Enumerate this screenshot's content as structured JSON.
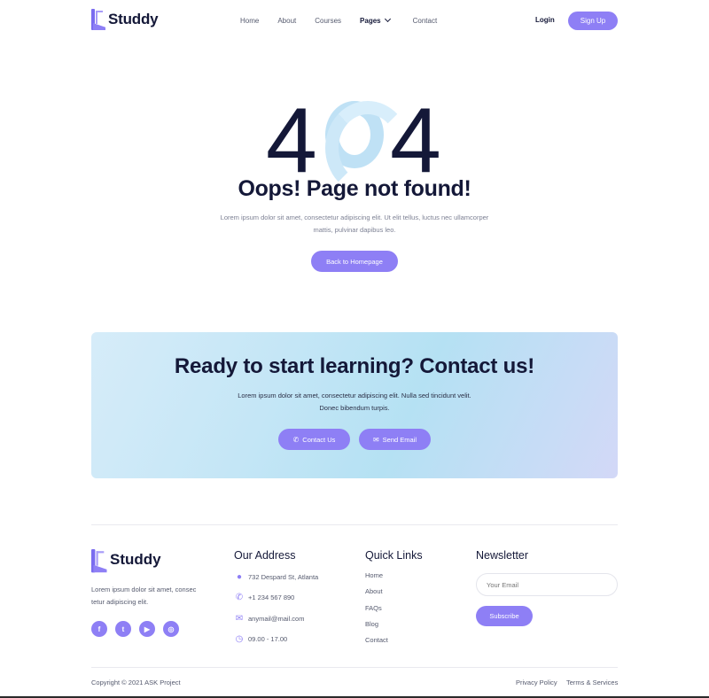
{
  "header": {
    "brand": "Studdy",
    "nav": [
      "Home",
      "About",
      "Courses",
      "Pages",
      "Contact"
    ],
    "login": "Login",
    "signup": "Sign Up"
  },
  "hero": {
    "code_left": "4",
    "code_right": "4",
    "title": "Oops! Page not found!",
    "text": "Lorem ipsum dolor sit amet, consectetur adipiscing elit. Ut elit tellus, luctus nec ullamcorper mattis, pulvinar dapibus leo.",
    "button": "Back to Homepage"
  },
  "cta": {
    "title": "Ready to start learning? Contact us!",
    "text": "Lorem ipsum dolor sit amet, consectetur adipiscing elit. Nulla sed tincidunt velit. Donec bibendum turpis.",
    "contact_button": "Contact Us",
    "email_button": "Send Email"
  },
  "footer": {
    "brand": "Studdy",
    "description": "Lorem ipsum dolor sit amet, consec tetur adipiscing elit.",
    "socials": [
      "facebook-icon",
      "twitter-icon",
      "youtube-icon",
      "instagram-icon"
    ],
    "address_heading": "Our Address",
    "address": {
      "street": "732 Despard St, Atlanta",
      "phone": "+1 234 567 890",
      "email": "anymail@mail.com",
      "hours": "09.00 - 17.00"
    },
    "links_heading": "Quick Links",
    "links": [
      "Home",
      "About",
      "FAQs",
      "Blog",
      "Contact"
    ],
    "newsletter_heading": "Newsletter",
    "newsletter_placeholder": "Your Email",
    "subscribe": "Subscribe",
    "copyright": "Copyright © 2021 ASK Project",
    "privacy": "Privacy Policy",
    "terms": "Terms & Services"
  },
  "colors": {
    "accent": "#8e7ff5",
    "text_dark": "#141838",
    "text_muted": "#7d8194"
  }
}
